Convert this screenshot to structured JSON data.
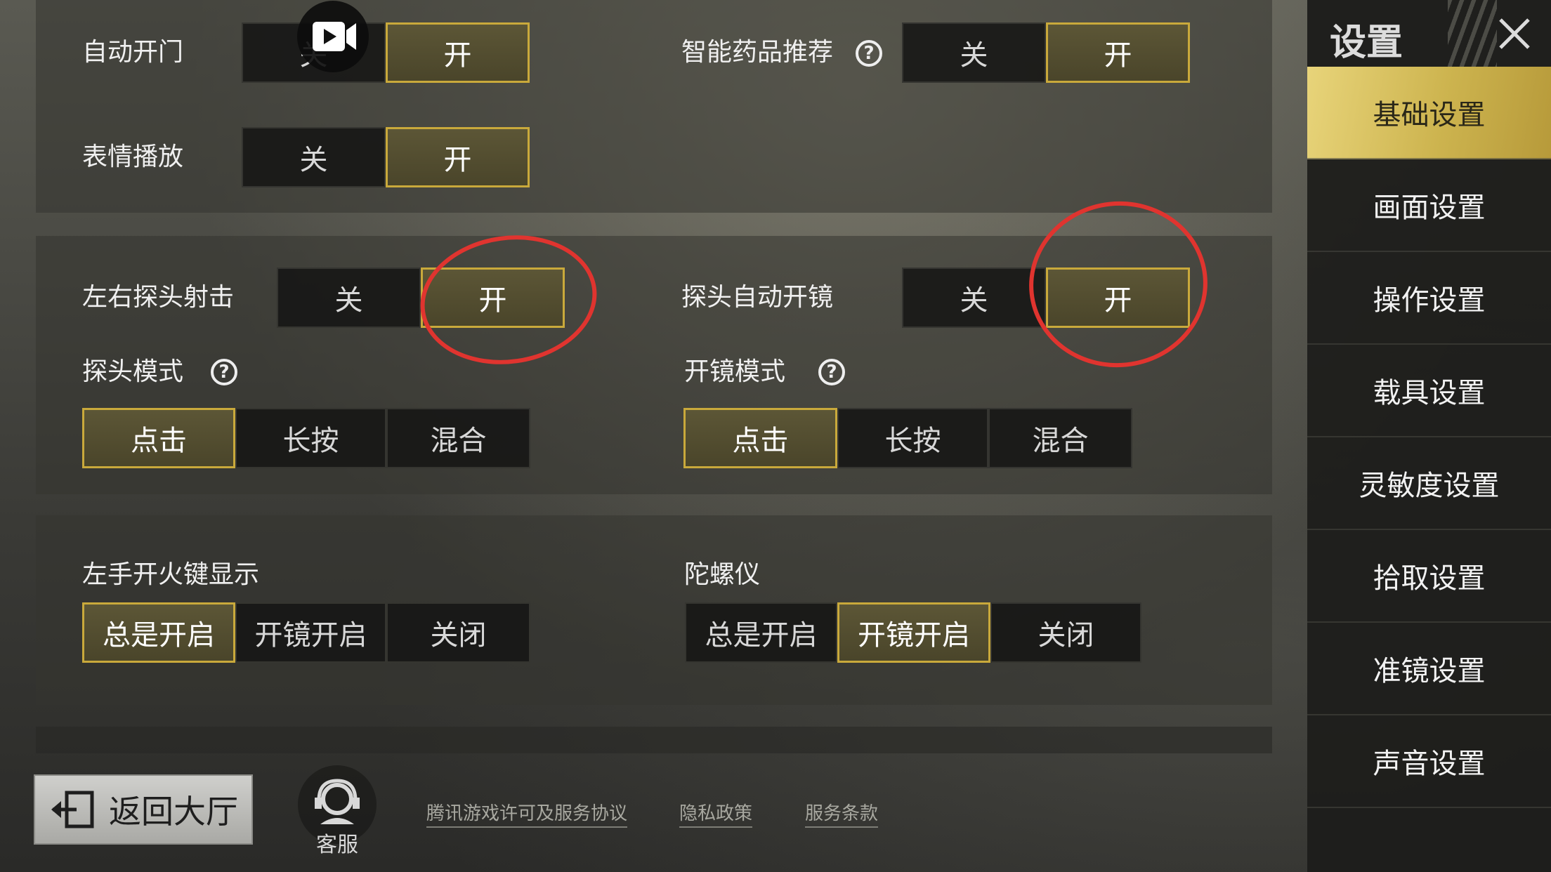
{
  "settings": {
    "auto_door": {
      "label": "自动开门",
      "options": [
        "关",
        "开"
      ],
      "selected": "开"
    },
    "smart_meds": {
      "label": "智能药品推荐",
      "options": [
        "关",
        "开"
      ],
      "selected": "开"
    },
    "emote_play": {
      "label": "表情播放",
      "options": [
        "关",
        "开"
      ],
      "selected": "开"
    },
    "lean_fire": {
      "label": "左右探头射击",
      "options": [
        "关",
        "开"
      ],
      "selected": "开"
    },
    "lean_auto_scope": {
      "label": "探头自动开镜",
      "options": [
        "关",
        "开"
      ],
      "selected": "开"
    },
    "lean_mode": {
      "label": "探头模式",
      "options": [
        "点击",
        "长按",
        "混合"
      ],
      "selected": "点击"
    },
    "scope_mode": {
      "label": "开镜模式",
      "options": [
        "点击",
        "长按",
        "混合"
      ],
      "selected": "点击"
    },
    "left_fire_display": {
      "label": "左手开火键显示",
      "options": [
        "总是开启",
        "开镜开启",
        "关闭"
      ],
      "selected": "总是开启"
    },
    "gyroscope": {
      "label": "陀螺仪",
      "options": [
        "总是开启",
        "开镜开启",
        "关闭"
      ],
      "selected": "开镜开启"
    }
  },
  "sidebar": {
    "title": "设置",
    "items": [
      "基础设置",
      "画面设置",
      "操作设置",
      "载具设置",
      "灵敏度设置",
      "拾取设置",
      "准镜设置",
      "声音设置"
    ],
    "active": "基础设置"
  },
  "bottom": {
    "back_label": "返回大厅",
    "service_label": "客服",
    "links": [
      "腾讯游戏许可及服务协议",
      "隐私政策",
      "服务条款"
    ]
  },
  "help_glyph": "?",
  "icons": [
    "record-video-icon",
    "close-icon",
    "exit-door-icon",
    "headset-support-icon",
    "help-icon"
  ],
  "colors": {
    "accent_gold": "#c9a93b",
    "sidebar_active": "#e0c866",
    "annotation_red": "#e0342f"
  }
}
